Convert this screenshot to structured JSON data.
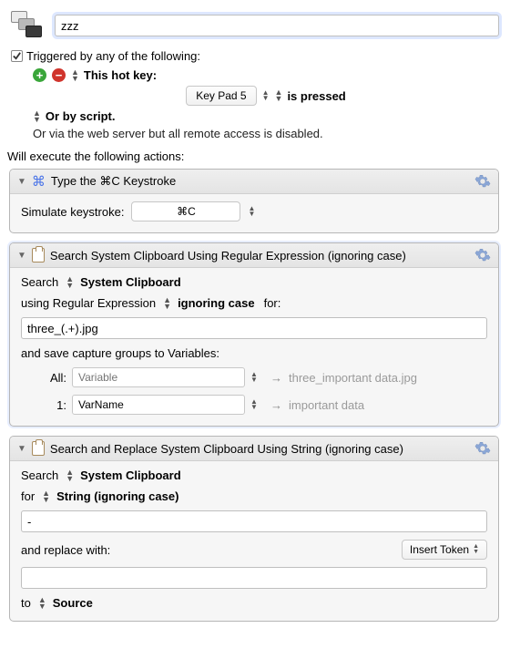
{
  "macro": {
    "name_value": "zzz"
  },
  "trigger": {
    "checkbox_checked": true,
    "label": "Triggered by any of the following:",
    "hotkey_label": "This hot key:",
    "hotkey_value": "Key Pad 5",
    "hotkey_condition": "is pressed",
    "script_label": "Or by script.",
    "webserver_note": "Or via the web server but all remote access is disabled."
  },
  "exec_label": "Will execute the following actions:",
  "actions": [
    {
      "title": "Type the ⌘C Keystroke",
      "body": {
        "label": "Simulate keystroke:",
        "value": "⌘C"
      }
    },
    {
      "title": "Search System Clipboard Using Regular Expression (ignoring case)",
      "body": {
        "search_label": "Search",
        "search_target": "System Clipboard",
        "using_label": "using Regular Expression",
        "case_label": "ignoring case",
        "for_label": "for:",
        "pattern_value": "three_(.+).jpg",
        "save_label": "and save capture groups to Variables:",
        "rows": [
          {
            "lbl": "All:",
            "value_ph": "Variable",
            "value": "",
            "example": "three_important data.jpg"
          },
          {
            "lbl": "1:",
            "value_ph": "",
            "value": "VarName",
            "example": "important data"
          }
        ]
      }
    },
    {
      "title": "Search and Replace System Clipboard Using String (ignoring case)",
      "body": {
        "search_label": "Search",
        "search_target": "System Clipboard",
        "for_label": "for",
        "for_option": "String (ignoring case)",
        "for_value": "-",
        "replace_label": "and replace with:",
        "insert_token": "Insert Token",
        "replace_value": "",
        "to_label": "to",
        "to_target": "Source"
      }
    }
  ]
}
